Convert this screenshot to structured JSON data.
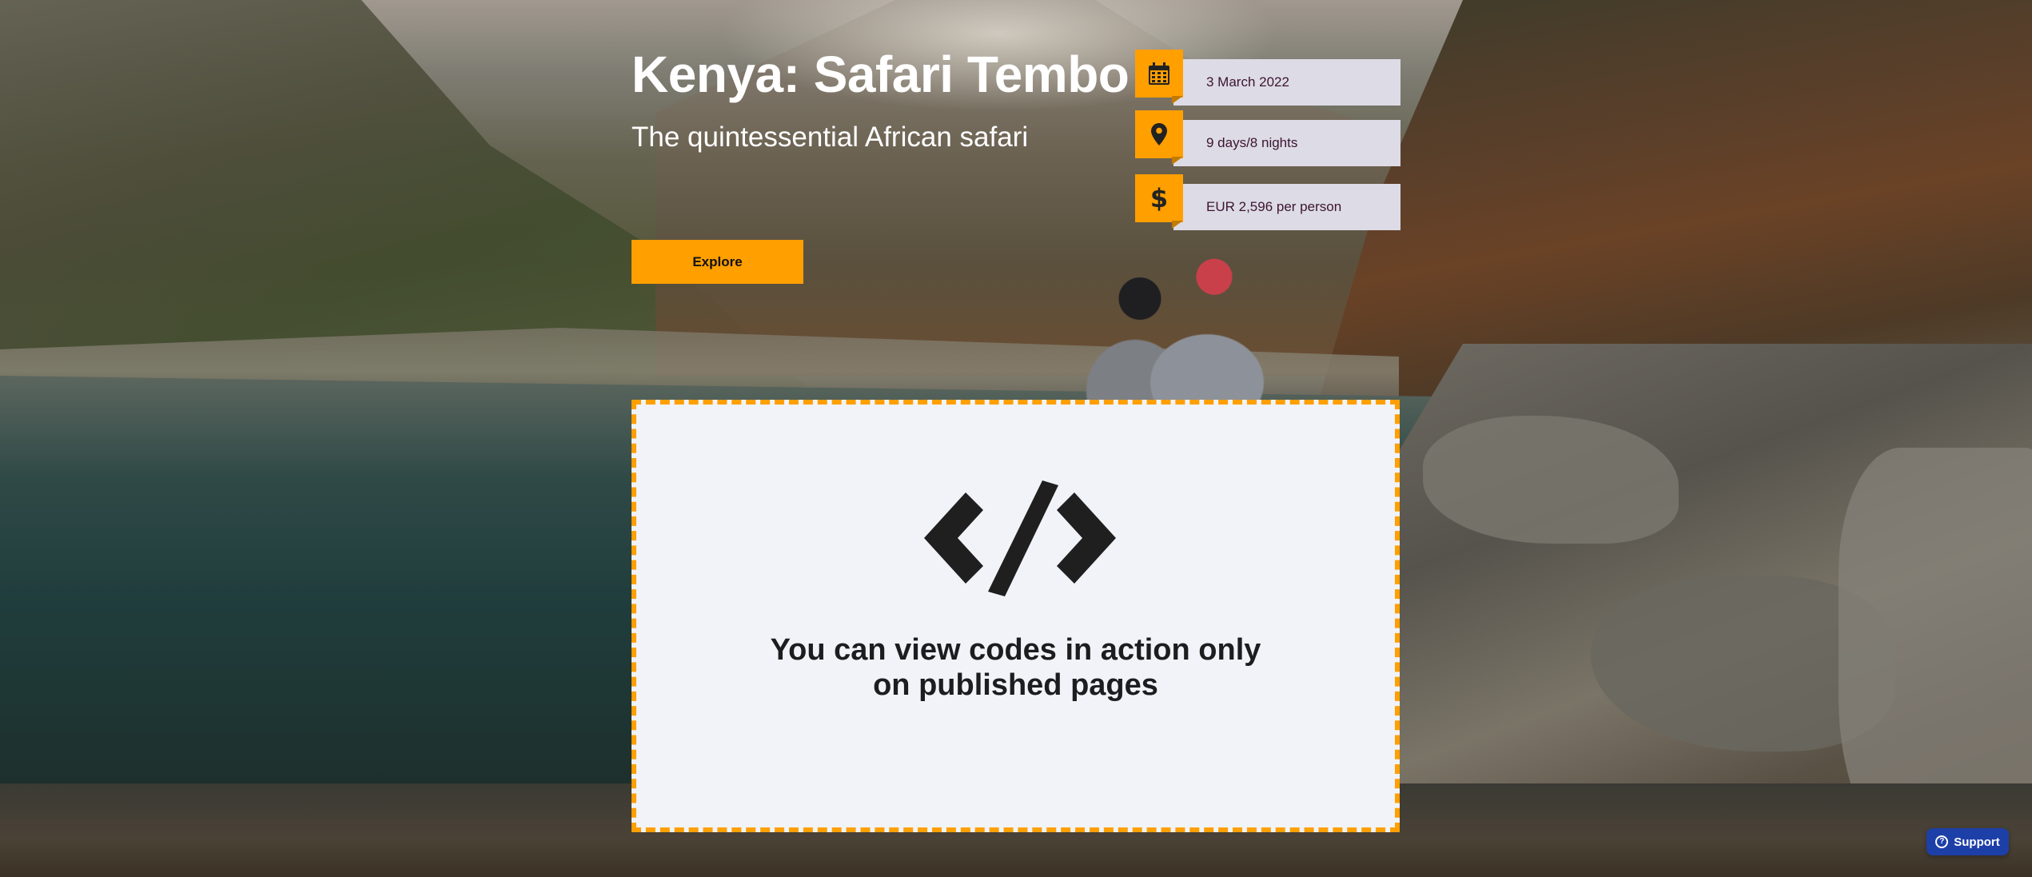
{
  "hero": {
    "title": "Kenya: Safari Tembo",
    "subtitle": "The quintessential African safari",
    "cta_label": "Explore"
  },
  "info": {
    "date": {
      "icon": "calendar-icon",
      "text": "3 March 2022"
    },
    "duration": {
      "icon": "location-pin-icon",
      "text": "9 days/8 nights"
    },
    "price": {
      "icon": "dollar-icon",
      "text": "EUR 2,596 per person"
    }
  },
  "code_placeholder": {
    "icon": "code-icon",
    "line1": "You can view codes in action only",
    "line2": "on published pages"
  },
  "support": {
    "icon": "question-circle-icon",
    "label": "Support"
  },
  "colors": {
    "accent": "#ff9f00",
    "info_background": "#dcdbe6",
    "info_text": "#3d1430",
    "support_button": "#1d3fa8",
    "placeholder_background": "#f1f3f9"
  }
}
